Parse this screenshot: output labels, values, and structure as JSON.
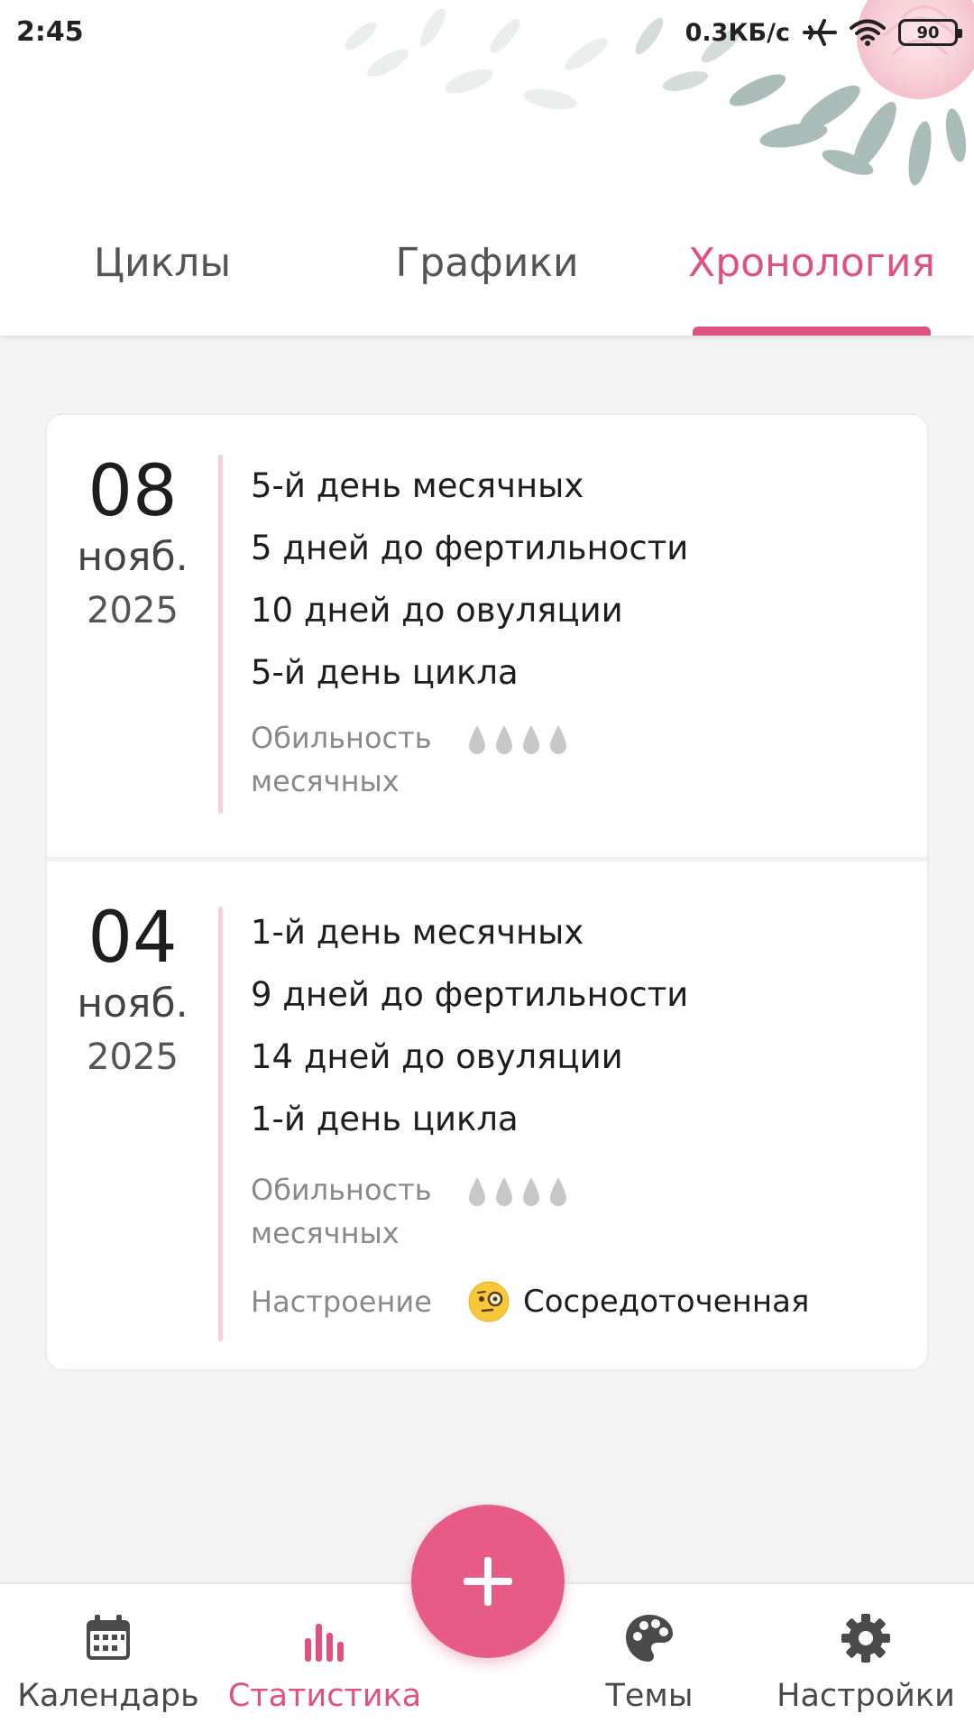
{
  "status_bar": {
    "time": "2:45",
    "network_speed": "0.3КБ/с",
    "battery": "90"
  },
  "tabs": [
    {
      "label": "Циклы",
      "active": false
    },
    {
      "label": "Графики",
      "active": false
    },
    {
      "label": "Хронология",
      "active": true
    }
  ],
  "timeline": {
    "entries": [
      {
        "day": "08",
        "month": "нояб.",
        "year": "2025",
        "lines": [
          "5-й день месячных",
          "5 дней до фертильности",
          "10 дней до овуляции",
          "5-й день цикла"
        ],
        "flow_label": "Обильность месячных",
        "flow_level": "0 of 4 drops"
      },
      {
        "day": "04",
        "month": "нояб.",
        "year": "2025",
        "lines": [
          "1-й день месячных",
          "9 дней до фертильности",
          "14 дней до овуляции",
          "1-й день цикла"
        ],
        "flow_label": "Обильность месячных",
        "flow_level": "0 of 4 drops",
        "mood_label": "Настроение",
        "mood_value": "Сосредоточенная",
        "mood_icon": "monocle-face-icon"
      }
    ]
  },
  "fab": {
    "icon": "plus-icon"
  },
  "bottom_nav": [
    {
      "label": "Календарь",
      "icon": "calendar-icon",
      "active": false
    },
    {
      "label": "Статистика",
      "icon": "bar-chart-icon",
      "active": true
    },
    {
      "label": "Темы",
      "icon": "palette-icon",
      "active": false
    },
    {
      "label": "Настройки",
      "icon": "gear-icon",
      "active": false
    }
  ],
  "colors": {
    "accent": "#e0527e",
    "fab": "#e65c86",
    "timeline_line": "#f7cfd8",
    "muted_text": "#8a8a8a",
    "drop_inactive": "#c8c8c8"
  }
}
